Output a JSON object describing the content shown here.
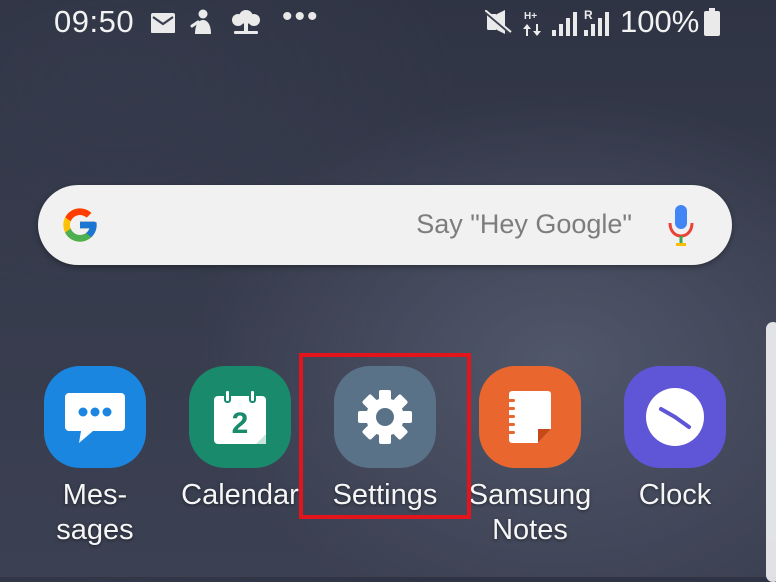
{
  "status_bar": {
    "time": "09:50",
    "battery_percent": "100%",
    "network_h_plus": "H+",
    "network_r": "R",
    "icons": [
      "mail-icon",
      "notification-icon",
      "tree-icon",
      "more-icon",
      "vibrate-icon",
      "signal-icon",
      "battery-icon"
    ]
  },
  "search": {
    "hint": "Say \"Hey Google\"",
    "icons": [
      "google-g-icon",
      "mic-icon"
    ]
  },
  "apps": [
    {
      "label": "Mes-\nsages",
      "icon": "messages-icon",
      "color": "#1b86e0"
    },
    {
      "label": "Calendar",
      "icon": "calendar-icon",
      "color": "#1a8a6c",
      "badge": "2"
    },
    {
      "label": "Settings",
      "icon": "gear-icon",
      "color": "#5a7288"
    },
    {
      "label": "Samsung\nNotes",
      "icon": "notes-icon",
      "color": "#e9672f"
    },
    {
      "label": "Clock",
      "icon": "clock-icon",
      "color": "#5e56d6"
    }
  ],
  "colors": {
    "highlight": "#e3141b",
    "search_bg": "#f1f1f1"
  }
}
